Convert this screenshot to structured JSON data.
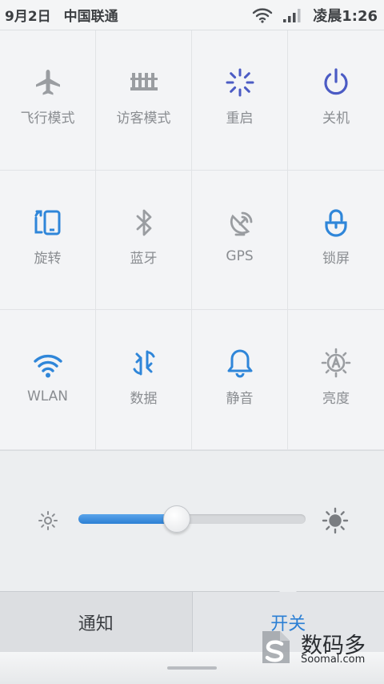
{
  "status_bar": {
    "date": "9月2日",
    "carrier": "中国联通",
    "time": "凌晨1:26",
    "icons": [
      "wifi-icon",
      "signal-icon"
    ]
  },
  "toggles": [
    {
      "label": "飞行模式",
      "icon": "airplane-icon",
      "state": "off"
    },
    {
      "label": "访客模式",
      "icon": "guest-mode-icon",
      "state": "off"
    },
    {
      "label": "重启",
      "icon": "reboot-icon",
      "state": "action"
    },
    {
      "label": "关机",
      "icon": "power-icon",
      "state": "action"
    },
    {
      "label": "旋转",
      "icon": "rotate-icon",
      "state": "on"
    },
    {
      "label": "蓝牙",
      "icon": "bluetooth-icon",
      "state": "off"
    },
    {
      "label": "GPS",
      "icon": "gps-icon",
      "state": "off"
    },
    {
      "label": "锁屏",
      "icon": "lock-screen-icon",
      "state": "action"
    },
    {
      "label": "WLAN",
      "icon": "wifi-icon",
      "state": "on"
    },
    {
      "label": "数据",
      "icon": "data-icon",
      "state": "on"
    },
    {
      "label": "静音",
      "icon": "bell-icon",
      "state": "on"
    },
    {
      "label": "亮度",
      "icon": "auto-brightness-icon",
      "state": "off"
    }
  ],
  "brightness": {
    "level": 0.43,
    "min_icon": "sun-small-icon",
    "max_icon": "sun-large-icon"
  },
  "tabs": {
    "notify_label": "通知",
    "switch_label": "开关",
    "active": "switch"
  },
  "watermark": {
    "brand_cn": "数码多",
    "brand_en": "Soomal.com"
  },
  "colors": {
    "accent": "#2b7fd4",
    "active_icon": "#2f86d9",
    "inactive_icon": "#9a9da1",
    "action_icon": "#4b5bc4"
  }
}
